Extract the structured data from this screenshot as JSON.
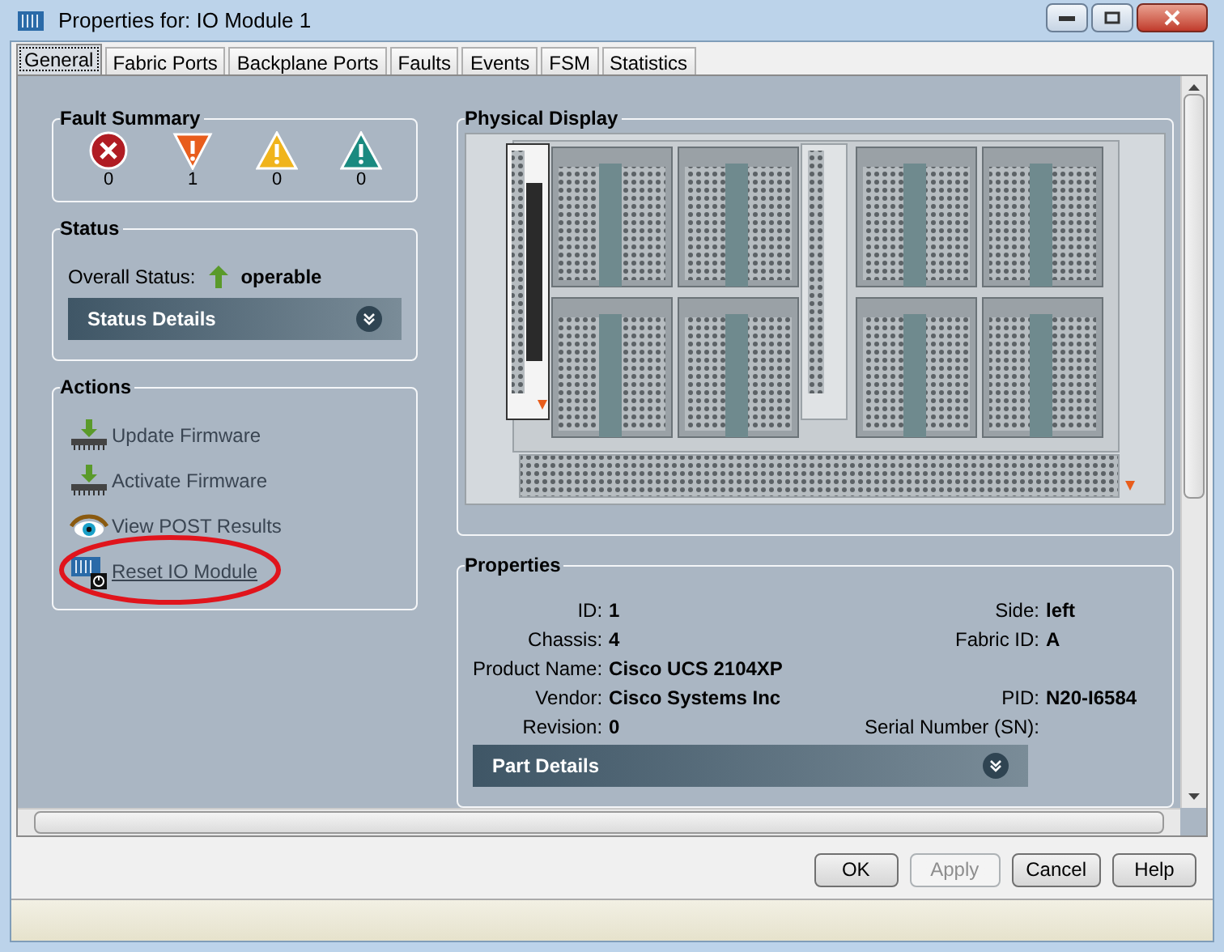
{
  "window": {
    "title": "Properties for: IO Module 1"
  },
  "tabs": [
    {
      "label": "General",
      "selected": true
    },
    {
      "label": "Fabric Ports",
      "selected": false
    },
    {
      "label": "Backplane Ports",
      "selected": false
    },
    {
      "label": "Faults",
      "selected": false
    },
    {
      "label": "Events",
      "selected": false
    },
    {
      "label": "FSM",
      "selected": false
    },
    {
      "label": "Statistics",
      "selected": false
    }
  ],
  "fault_summary": {
    "title": "Fault Summary",
    "faults": [
      {
        "kind": "critical",
        "count": "0"
      },
      {
        "kind": "major",
        "count": "1"
      },
      {
        "kind": "minor",
        "count": "0"
      },
      {
        "kind": "warning",
        "count": "0"
      }
    ]
  },
  "status": {
    "title": "Status",
    "label": "Overall Status:",
    "value": "operable",
    "details": {
      "label": "Status Details",
      "expanded": false
    }
  },
  "actions": {
    "title": "Actions",
    "items": [
      {
        "kind": "update",
        "label": "Update Firmware",
        "underlined": false,
        "circled": false
      },
      {
        "kind": "activate",
        "label": "Activate Firmware",
        "underlined": false,
        "circled": false
      },
      {
        "kind": "view",
        "label": "View POST Results",
        "underlined": false,
        "circled": false
      },
      {
        "kind": "reset",
        "label": "Reset IO Module",
        "underlined": true,
        "circled": true
      }
    ]
  },
  "physical_display": {
    "title": "Physical Display"
  },
  "properties": {
    "title": "Properties",
    "left": [
      {
        "label": "ID:",
        "value": "1"
      },
      {
        "label": "Chassis:",
        "value": "4"
      },
      {
        "label": "Product Name:",
        "value": "Cisco UCS 2104XP"
      },
      {
        "label": "Vendor:",
        "value": "Cisco Systems Inc"
      },
      {
        "label": "Revision:",
        "value": "0"
      }
    ],
    "right": [
      {
        "label": "Side:",
        "value": "left"
      },
      {
        "label": "Fabric ID:",
        "value": "A"
      },
      {
        "label": "PID:",
        "value": "N20-I6584"
      },
      {
        "label": "Serial Number (SN):"
      }
    ],
    "details": {
      "label": "Part Details",
      "expanded": false
    }
  },
  "buttons": [
    {
      "label": "OK",
      "disabled": false
    },
    {
      "label": "Apply",
      "disabled": true
    },
    {
      "label": "Cancel",
      "disabled": false
    },
    {
      "label": "Help",
      "disabled": false
    }
  ]
}
